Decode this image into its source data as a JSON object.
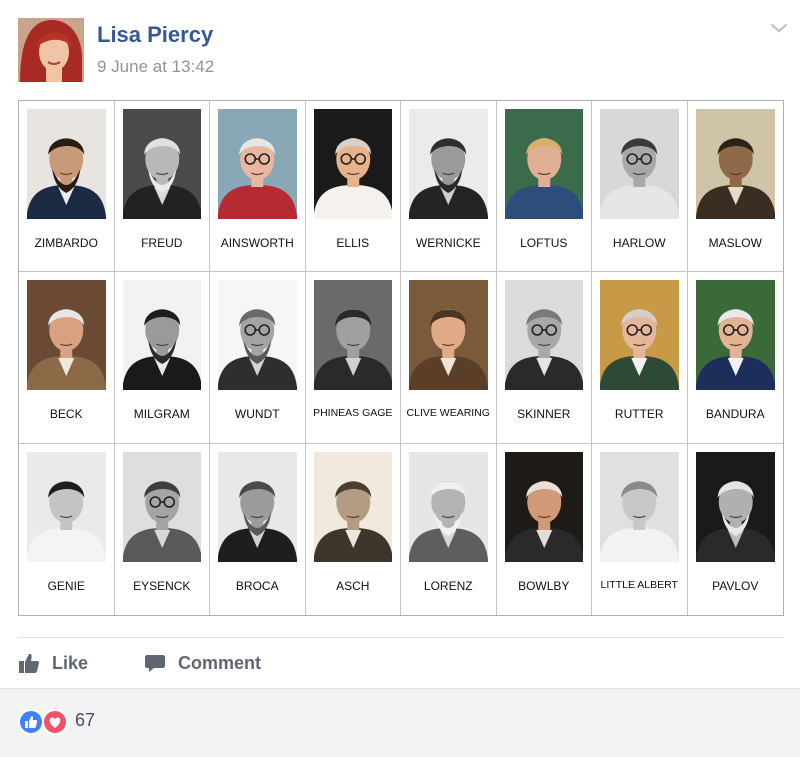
{
  "post": {
    "author": "Lisa Piercy",
    "timestamp": "9 June at 13:42"
  },
  "grid": {
    "cells": [
      {
        "name": "ZIMBARDO",
        "bg": "#e8e4e0",
        "skin": "#c99a7a",
        "hair": "#2a1d14",
        "suit": "#1d2a44",
        "shirt": "#e9eef5",
        "beard": "#2a1d14",
        "glasses": false,
        "bw": false
      },
      {
        "name": "FREUD",
        "bg": "#4a4a4a",
        "skin": "#b8b8b8",
        "hair": "#e0e0e0",
        "suit": "#222222",
        "shirt": "#d8d8d8",
        "beard": "#eaeaea",
        "glasses": false,
        "bw": true
      },
      {
        "name": "AINSWORTH",
        "bg": "#8aa7b8",
        "skin": "#e8b7a0",
        "hair": "#e6e6e6",
        "suit": "#b52a33",
        "shirt": "#b52a33",
        "beard": "",
        "glasses": true,
        "bw": false
      },
      {
        "name": "ELLIS",
        "bg": "#1a1a1a",
        "skin": "#e6b28a",
        "hair": "#d8d0c8",
        "suit": "#f5f1ec",
        "shirt": "#f5f1ec",
        "beard": "",
        "glasses": true,
        "bw": false
      },
      {
        "name": "WERNICKE",
        "bg": "#ebebeb",
        "skin": "#9a9a9a",
        "hair": "#2e2e2e",
        "suit": "#242424",
        "shirt": "#cfcfcf",
        "beard": "#2a2a2a",
        "glasses": false,
        "bw": true
      },
      {
        "name": "LOFTUS",
        "bg": "#3a6b4a",
        "skin": "#e0b094",
        "hair": "#d9b06a",
        "suit": "#2d4e7a",
        "shirt": "#2d4e7a",
        "beard": "",
        "glasses": false,
        "bw": false
      },
      {
        "name": "HARLOW",
        "bg": "#d8d8d8",
        "skin": "#a8a8a8",
        "hair": "#3a3a3a",
        "suit": "#e6e6e6",
        "shirt": "#e6e6e6",
        "beard": "",
        "glasses": true,
        "bw": true
      },
      {
        "name": "MASLOW",
        "bg": "#cfc3a8",
        "skin": "#8e6a4a",
        "hair": "#2e2218",
        "suit": "#3a2e22",
        "shirt": "#e5dccb",
        "beard": "",
        "glasses": false,
        "bw": false
      },
      {
        "name": "BECK",
        "bg": "#6a4a34",
        "skin": "#d9a282",
        "hair": "#e6e6e6",
        "suit": "#8c6a48",
        "shirt": "#f0e8dc",
        "beard": "",
        "glasses": false,
        "bw": false
      },
      {
        "name": "MILGRAM",
        "bg": "#f2f2f2",
        "skin": "#9a9a9a",
        "hair": "#1e1e1e",
        "suit": "#1a1a1a",
        "shirt": "#e8e8e8",
        "beard": "#2a2a2a",
        "glasses": false,
        "bw": true
      },
      {
        "name": "WUNDT",
        "bg": "#f6f6f6",
        "skin": "#a4a4a4",
        "hair": "#6a6a6a",
        "suit": "#2e2e2e",
        "shirt": "#d4d4d4",
        "beard": "#5a5a5a",
        "glasses": true,
        "bw": true
      },
      {
        "name": "PHINEAS GAGE",
        "bg": "#6a6a6a",
        "skin": "#a0a0a0",
        "hair": "#2a2a2a",
        "suit": "#2a2a2a",
        "shirt": "#d0d0d0",
        "beard": "",
        "glasses": false,
        "bw": true
      },
      {
        "name": "CLIVE WEARING",
        "bg": "#7a5a3a",
        "skin": "#e2ab88",
        "hair": "#4a3424",
        "suit": "#5a3e28",
        "shirt": "#ede4d6",
        "beard": "",
        "glasses": false,
        "bw": false
      },
      {
        "name": "SKINNER",
        "bg": "#dcdcdc",
        "skin": "#a8a8a8",
        "hair": "#7a7a7a",
        "suit": "#2a2a2a",
        "shirt": "#e4e4e4",
        "beard": "",
        "glasses": true,
        "bw": true
      },
      {
        "name": "RUTTER",
        "bg": "#c89a48",
        "skin": "#e4b69a",
        "hair": "#d4cfc8",
        "suit": "#2e4a36",
        "shirt": "#f2f2f2",
        "beard": "",
        "glasses": true,
        "bw": false
      },
      {
        "name": "BANDURA",
        "bg": "#3a6a3a",
        "skin": "#e2b496",
        "hair": "#e8e8e8",
        "suit": "#1d2e5a",
        "shirt": "#f0f2f8",
        "beard": "",
        "glasses": true,
        "bw": false
      },
      {
        "name": "GENIE",
        "bg": "#eaeaea",
        "skin": "#c4c4c4",
        "hair": "#1e1e1e",
        "suit": "#f4f4f4",
        "shirt": "#f4f4f4",
        "beard": "",
        "glasses": false,
        "bw": true
      },
      {
        "name": "EYSENCK",
        "bg": "#dedede",
        "skin": "#a4a4a4",
        "hair": "#3e3e3e",
        "suit": "#5a5a5a",
        "shirt": "#d8d8d8",
        "beard": "",
        "glasses": true,
        "bw": true
      },
      {
        "name": "BROCA",
        "bg": "#e8e8e8",
        "skin": "#9c9c9c",
        "hair": "#4a4a4a",
        "suit": "#1e1e1e",
        "shirt": "#d2d2d2",
        "beard": "#5a5a5a",
        "glasses": false,
        "bw": true
      },
      {
        "name": "ASCH",
        "bg": "#f0e9dc",
        "skin": "#b49c84",
        "hair": "#4a3e32",
        "suit": "#3e362c",
        "shirt": "#ede6da",
        "beard": "",
        "glasses": false,
        "bw": false
      },
      {
        "name": "LORENZ",
        "bg": "#e6e6e6",
        "skin": "#b4b4b4",
        "hair": "#efefef",
        "suit": "#5e5e5e",
        "shirt": "#d6d6d6",
        "beard": "#f2f2f2",
        "glasses": false,
        "bw": true
      },
      {
        "name": "BOWLBY",
        "bg": "#1e1a16",
        "skin": "#d29a78",
        "hair": "#e8e0d8",
        "suit": "#2a2a2a",
        "shirt": "#e2dcd4",
        "beard": "",
        "glasses": false,
        "bw": false
      },
      {
        "name": "LITTLE ALBERT",
        "bg": "#e0e0e0",
        "skin": "#c8c8c8",
        "hair": "#8a8a8a",
        "suit": "#f2f2f2",
        "shirt": "#f2f2f2",
        "beard": "",
        "glasses": false,
        "bw": true
      },
      {
        "name": "PAVLOV",
        "bg": "#1a1a1a",
        "skin": "#b0b0b0",
        "hair": "#e4e4e4",
        "suit": "#2a2a2a",
        "shirt": "#bcbcbc",
        "beard": "#e8e8e8",
        "glasses": false,
        "bw": true
      }
    ]
  },
  "actions": {
    "like_label": "Like",
    "comment_label": "Comment"
  },
  "reactions": {
    "count": "67",
    "icons": [
      "like-reaction-icon",
      "love-reaction-icon"
    ]
  },
  "colors": {
    "link": "#365899",
    "muted": "#90949c",
    "action_gray": "#606770",
    "like_blue": "#4080ff",
    "love_red": "#f25268",
    "bar_bg": "#f2f3f5"
  }
}
